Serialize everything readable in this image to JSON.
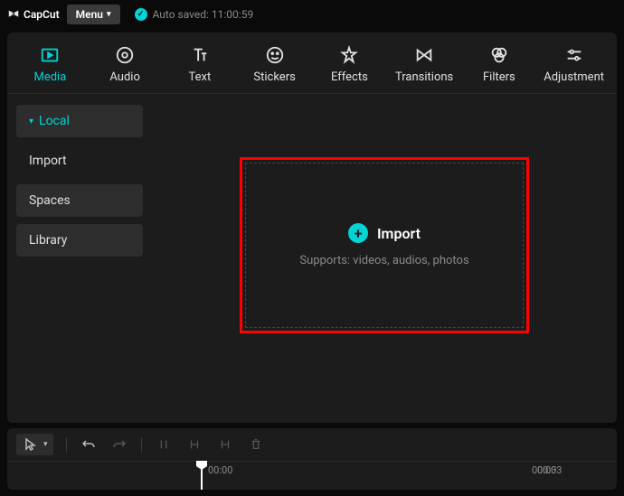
{
  "titlebar": {
    "app_name": "CapCut",
    "menu_label": "Menu",
    "autosave_text": "Auto saved: 11:00:59"
  },
  "tabs": [
    {
      "label": "Media",
      "icon": "media"
    },
    {
      "label": "Audio",
      "icon": "audio"
    },
    {
      "label": "Text",
      "icon": "text"
    },
    {
      "label": "Stickers",
      "icon": "stickers"
    },
    {
      "label": "Effects",
      "icon": "effects"
    },
    {
      "label": "Transitions",
      "icon": "transitions"
    },
    {
      "label": "Filters",
      "icon": "filters"
    },
    {
      "label": "Adjustment",
      "icon": "adjustment"
    }
  ],
  "sidebar": {
    "items": [
      {
        "label": "Local"
      },
      {
        "label": "Import"
      },
      {
        "label": "Spaces"
      },
      {
        "label": "Library"
      }
    ]
  },
  "drop": {
    "import_label": "Import",
    "supports_text": "Supports: videos, audios, photos"
  },
  "timeline": {
    "time1": "00:00",
    "time2": "00:03"
  }
}
